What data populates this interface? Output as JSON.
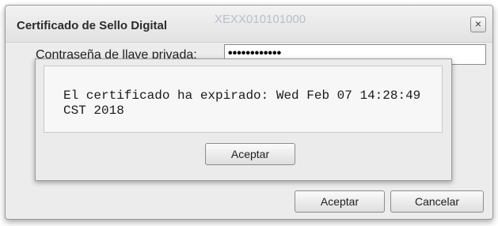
{
  "dialog": {
    "title": "Certificado de Sello Digital",
    "rfc": "XEXX010101000",
    "close_label": "×",
    "password_label": "Contraseña de llave privada:",
    "password_value": "••••••••••••",
    "accept_label": "Aceptar",
    "cancel_label": "Cancelar"
  },
  "alert": {
    "message": "El certificado ha expirado: Wed Feb 07 14:28:49 CST 2018",
    "ok_label": "Aceptar"
  },
  "icons": {
    "close": "close-icon"
  }
}
